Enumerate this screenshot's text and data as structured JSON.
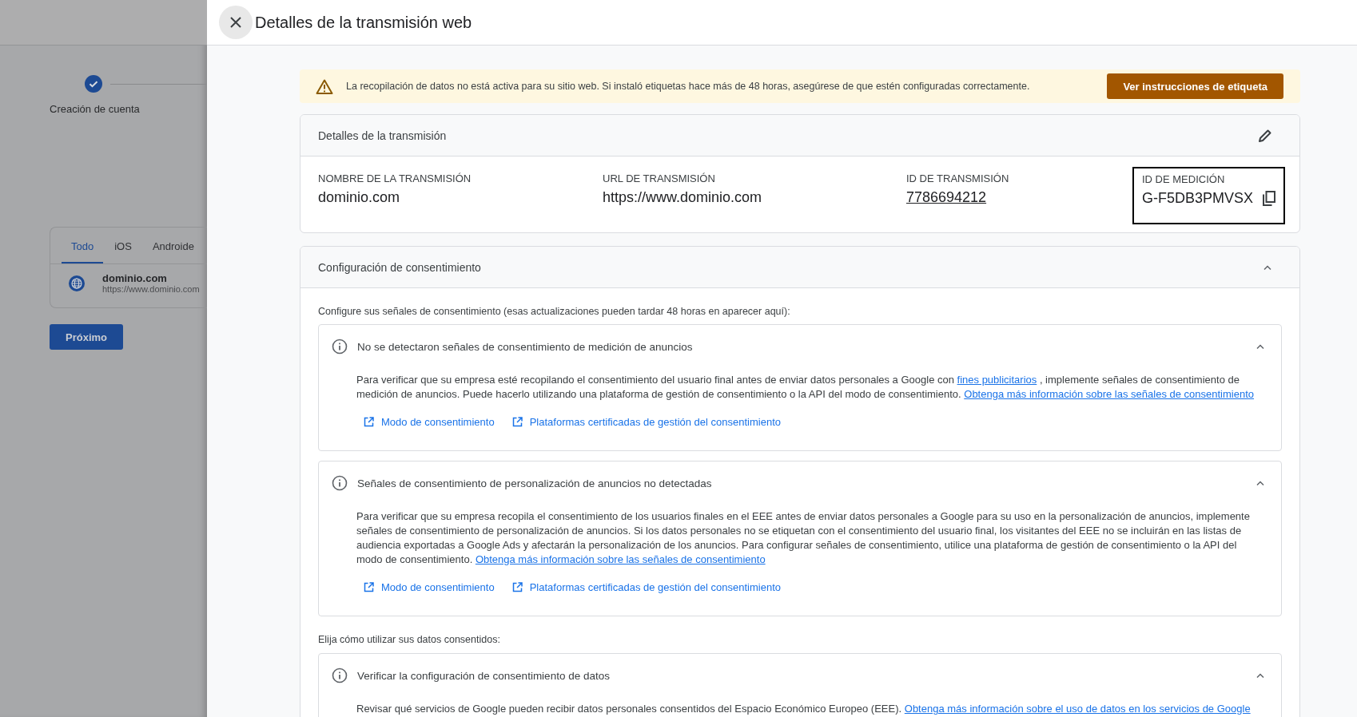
{
  "backdrop": {
    "step": {
      "label": "Creación de cuenta",
      "done": true
    },
    "tabs": [
      {
        "label": "Todo",
        "selected": true
      },
      {
        "label": "iOS",
        "selected": false
      },
      {
        "label": "Androide",
        "selected": false
      }
    ],
    "stream": {
      "name": "dominio.com",
      "url": "https://www.dominio.com"
    },
    "next_button": "Próximo"
  },
  "panel": {
    "title": "Detalles de la transmisión web"
  },
  "alert": {
    "message": "La recopilación de datos no está activa para su sitio web. Si instaló etiquetas hace más de 48 horas, asegúrese de que estén configuradas correctamente.",
    "button": "Ver instrucciones de etiqueta"
  },
  "details": {
    "title": "Detalles de la transmisión",
    "fields": [
      {
        "label": "NOMBRE DE LA TRANSMISIÓN",
        "value": "dominio.com",
        "kind": "text",
        "highlighted": false
      },
      {
        "label": "URL DE TRANSMISIÓN",
        "value": "https://www.dominio.com",
        "kind": "text",
        "highlighted": false
      },
      {
        "label": "ID DE TRANSMISIÓN",
        "value": "7786694212",
        "kind": "link",
        "highlighted": false
      },
      {
        "label": "ID DE MEDICIÓN",
        "value": "G-F5DB3PMVSX",
        "kind": "copy",
        "highlighted": true
      }
    ]
  },
  "consent": {
    "title": "Configuración de consentimiento",
    "expanded": true,
    "intro": "Configure sus señales de consentimiento (esas actualizaciones pueden tardar 48 horas en aparecer aquí):",
    "sections": [
      {
        "title": "No se detectaron señales de consentimiento de medición de anuncios",
        "expanded": true,
        "text": [
          {
            "text": "Para verificar que su empresa esté recopilando el consentimiento del usuario final antes de enviar datos personales a Google con ",
            "link": false
          },
          {
            "text": "fines publicitarios",
            "link": true
          },
          {
            "text": " , implemente señales de consentimiento de medición de anuncios. Puede hacerlo utilizando una plataforma de gestión de consentimiento o la API del modo de consentimiento. ",
            "link": false
          },
          {
            "text": "Obtenga más información sobre las señales de consentimiento",
            "link": true
          }
        ],
        "links": [
          "Modo de consentimiento",
          "Plataformas certificadas de gestión del consentimiento"
        ]
      },
      {
        "title": "Señales de consentimiento de personalización de anuncios no detectadas",
        "expanded": true,
        "text": [
          {
            "text": "Para verificar que su empresa recopila el consentimiento de los usuarios finales en el EEE antes de enviar datos personales a Google para su uso en la personalización de anuncios, implemente señales de consentimiento de personalización de anuncios. Si los datos personales no se etiquetan con el consentimiento del usuario final, los visitantes del EEE no se incluirán en las listas de audiencia exportadas a Google Ads y afectarán la personalización de los anuncios. Para configurar señales de consentimiento, utilice una plataforma de gestión de consentimiento o la API del modo de consentimiento. ",
            "link": false
          },
          {
            "text": "Obtenga más información sobre las señales de consentimiento",
            "link": true
          }
        ],
        "links": [
          "Modo de consentimiento",
          "Plataformas certificadas de gestión del consentimiento"
        ]
      }
    ],
    "usage_label": "Elija cómo utilizar sus datos consentidos:",
    "usage_sections": [
      {
        "title": "Verificar la configuración de consentimiento de datos",
        "expanded": true,
        "text": [
          {
            "text": "Revisar qué servicios de Google pueden recibir datos personales consentidos del Espacio Económico Europeo (EEE). ",
            "link": false
          },
          {
            "text": "Obtenga más información sobre el uso de datos en los servicios de Google",
            "link": true
          }
        ]
      }
    ]
  }
}
